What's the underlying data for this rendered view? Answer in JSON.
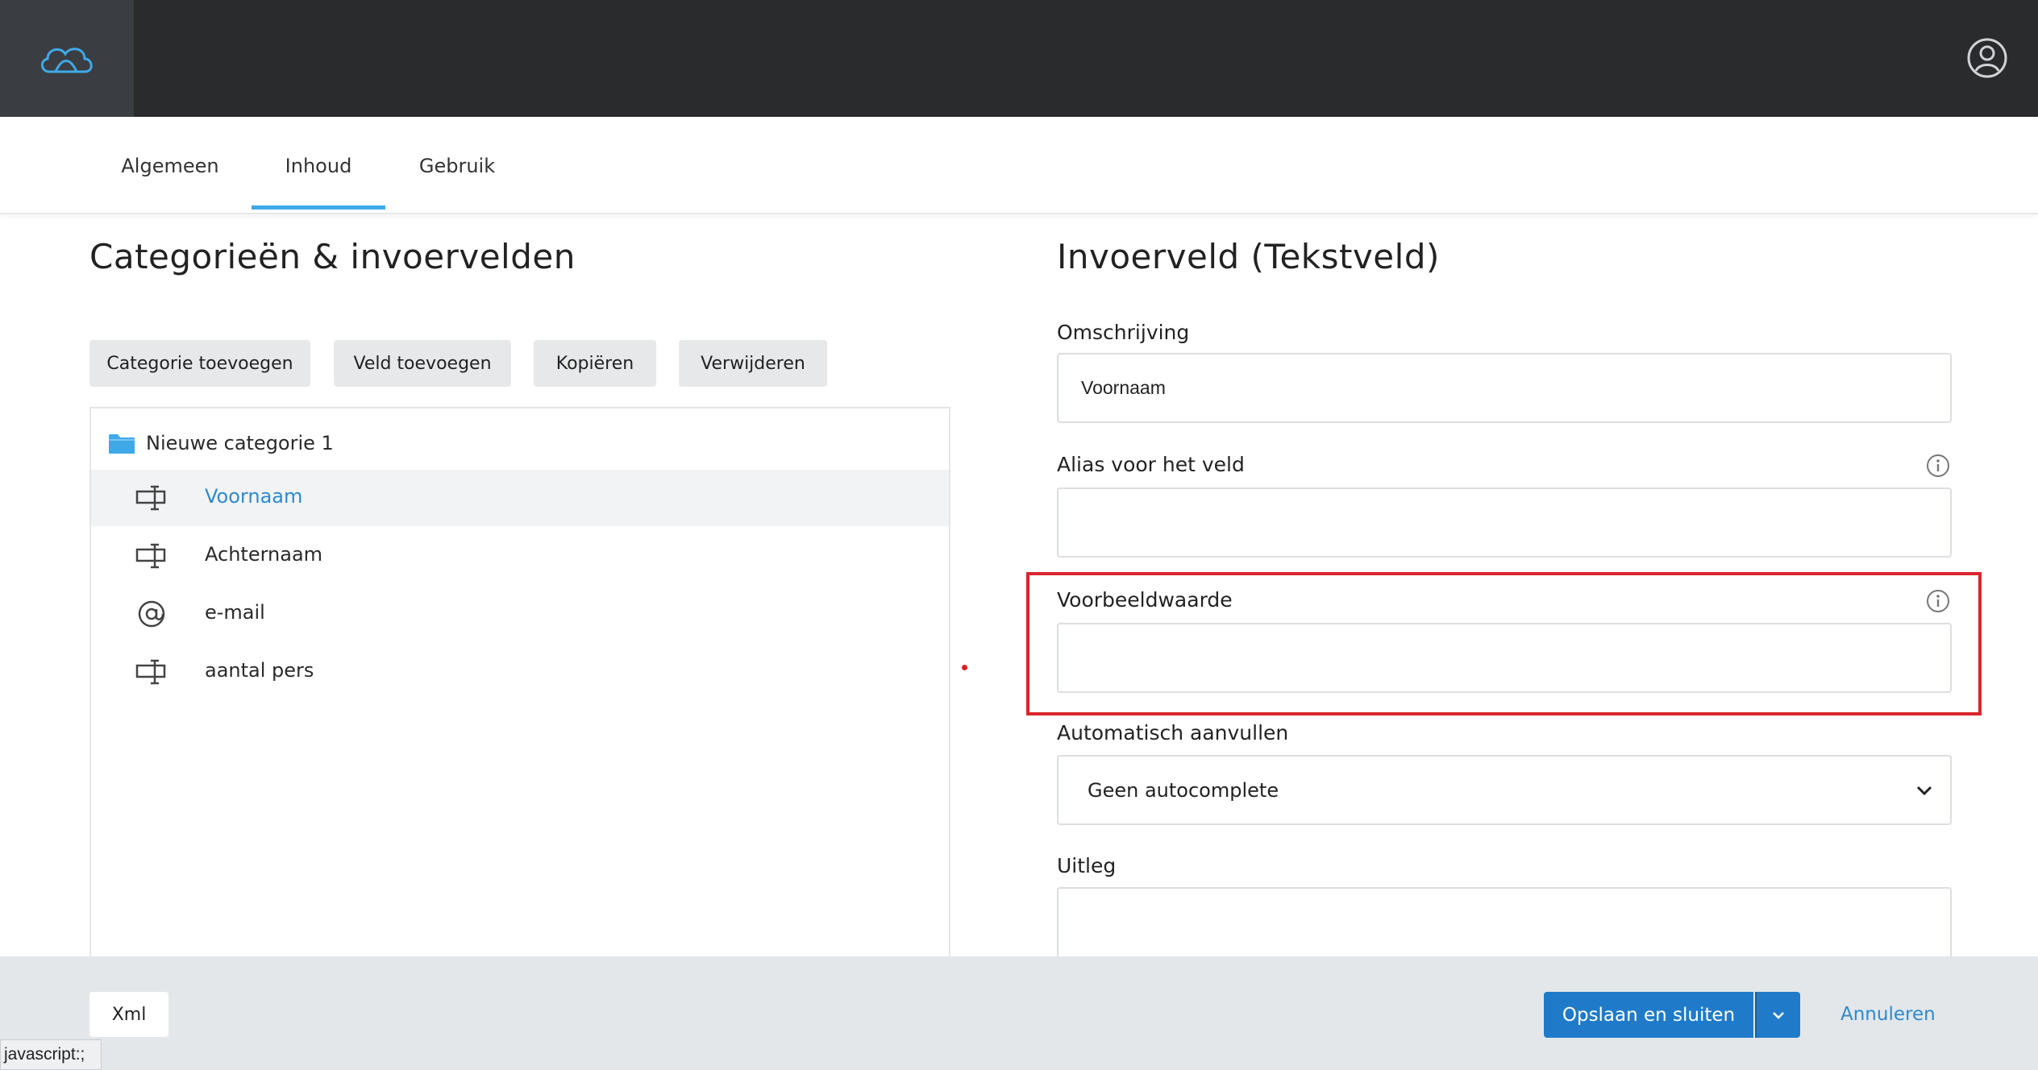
{
  "tabs": [
    {
      "label": "Algemeen",
      "active": false
    },
    {
      "label": "Inhoud",
      "active": true
    },
    {
      "label": "Gebruik",
      "active": false
    }
  ],
  "left": {
    "title": "Categorieën & invoervelden",
    "buttons": {
      "add_category": "Categorie toevoegen",
      "add_field": "Veld toevoegen",
      "copy": "Kopiëren",
      "delete": "Verwijderen"
    },
    "tree": {
      "category": "Nieuwe categorie 1",
      "items": [
        {
          "label": "Voornaam",
          "icon": "text-field-icon",
          "selected": true
        },
        {
          "label": "Achternaam",
          "icon": "text-field-icon",
          "selected": false
        },
        {
          "label": "e-mail",
          "icon": "at-sign-icon",
          "selected": false
        },
        {
          "label": "aantal pers",
          "icon": "text-field-icon",
          "selected": false
        }
      ]
    }
  },
  "right": {
    "title": "Invoerveld (Tekstveld)",
    "fields": {
      "description_label": "Omschrijving",
      "description_value": "Voornaam",
      "alias_label": "Alias voor het veld",
      "alias_value": "",
      "example_label": "Voorbeeldwaarde",
      "example_value": "",
      "autocomplete_label": "Automatisch aanvullen",
      "autocomplete_value": "Geen autocomplete",
      "explanation_label": "Uitleg",
      "explanation_value": ""
    }
  },
  "footer": {
    "xml_label": "Xml",
    "save_label": "Opslaan en sluiten",
    "cancel_label": "Annuleren"
  },
  "status_bar": "javascript:;",
  "colors": {
    "accent": "#3fa9e8",
    "primary_button": "#1f7bc9",
    "link": "#2d8ad0",
    "highlight_border": "#d9262b",
    "topbar": "#2a2b2d"
  }
}
